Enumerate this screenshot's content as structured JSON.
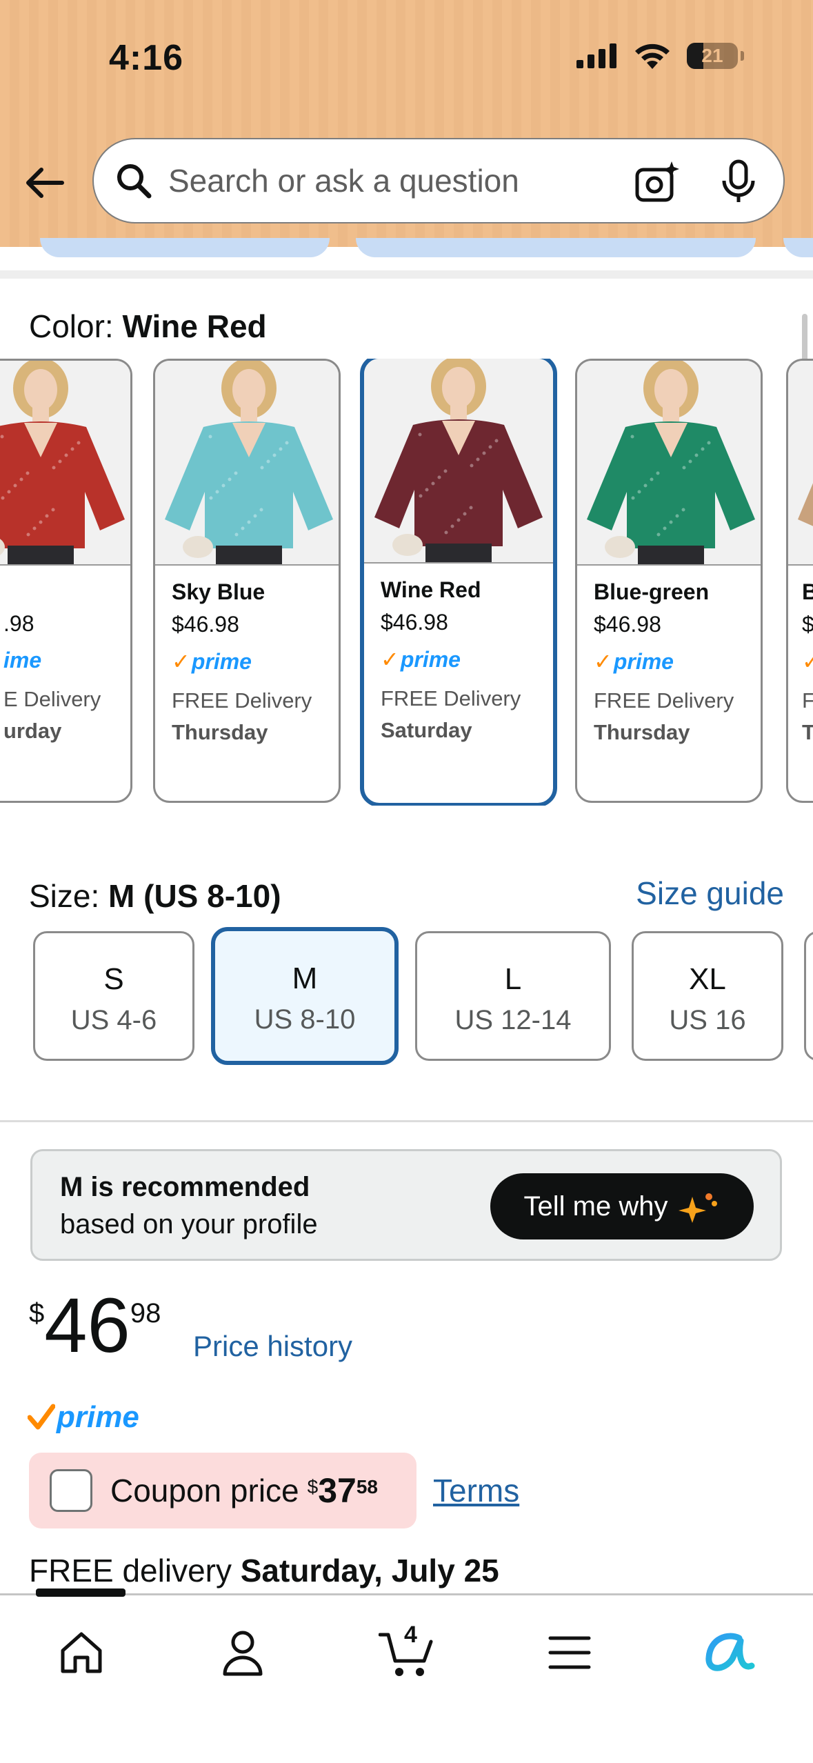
{
  "status_bar": {
    "time": "4:16",
    "battery": "21"
  },
  "search": {
    "placeholder": "Search or ask a question"
  },
  "color_section": {
    "label": "Color: ",
    "selected": "Wine Red",
    "swatches": [
      {
        "name": "",
        "price": ".98",
        "prime": "ime",
        "delivery": "E Delivery",
        "day": "urday",
        "color": "#b8322a"
      },
      {
        "name": "Sky Blue",
        "price": "$46.98",
        "prime": "prime",
        "delivery": "FREE Delivery",
        "day": "Thursday",
        "color": "#6fc4cc"
      },
      {
        "name": "Wine Red",
        "price": "$46.98",
        "prime": "prime",
        "delivery": "FREE Delivery",
        "day": "Saturday",
        "color": "#6e2730"
      },
      {
        "name": "Blue-green",
        "price": "$46.98",
        "prime": "prime",
        "delivery": "FREE Delivery",
        "day": "Thursday",
        "color": "#1f8a66"
      },
      {
        "name": "B",
        "price": "$",
        "prime": "",
        "delivery": "F",
        "day": "T",
        "color": "#c9a27d"
      }
    ]
  },
  "size_section": {
    "label": "Size: ",
    "selected": "M (US 8-10)",
    "guide": "Size guide",
    "sizes": [
      {
        "size": "S",
        "us": "US 4-6"
      },
      {
        "size": "M",
        "us": "US 8-10"
      },
      {
        "size": "L",
        "us": "US 12-14"
      },
      {
        "size": "XL",
        "us": "US 16"
      }
    ]
  },
  "recommendation": {
    "title": "M is recommended",
    "subtitle": "based on your profile",
    "button": "Tell me why"
  },
  "price": {
    "symbol": "$",
    "whole": "46",
    "fraction": "98",
    "history": "Price history"
  },
  "prime_label": "prime",
  "coupon": {
    "label": "Coupon price",
    "symbol": "$",
    "whole": "37",
    "fraction": "58",
    "terms": "Terms"
  },
  "delivery": {
    "prefix": "FREE delivery ",
    "date": "Saturday, July 25"
  },
  "nav": {
    "cart_count": "4"
  },
  "colors": {
    "accent_blue": "#2162a1",
    "header_bg": "#f0be8c",
    "prime_blue": "#1a98ff",
    "prime_orange": "#ff8a00"
  }
}
